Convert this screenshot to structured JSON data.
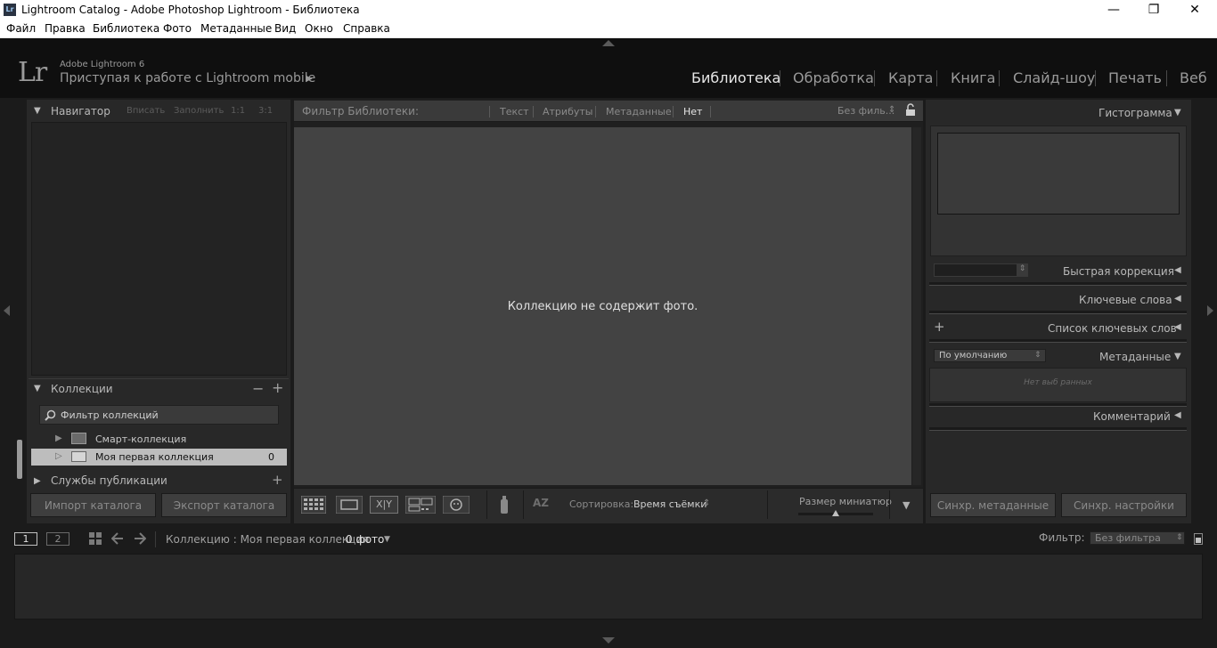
{
  "window": {
    "title": "Lightroom Catalog - Adobe Photoshop Lightroom - Библиотека",
    "app_icon": "Lr",
    "controls": [
      "—",
      "❐",
      "✕"
    ]
  },
  "menu": [
    "Файл",
    "Правка",
    "Библиотека",
    "Фото",
    "Метаданные",
    "Вид",
    "Окно",
    "Справка"
  ],
  "identity": {
    "logo": "Lr",
    "small": "Adobe Lightroom 6",
    "big": "Приступая к работе с Lightroom mobile",
    "play": "▶"
  },
  "modules": [
    "Библиотека",
    "Обработка",
    "Карта",
    "Книга",
    "Слайд-шоу",
    "Печать",
    "Веб"
  ],
  "navigator": {
    "title": "Навигатор",
    "options": [
      "Вписать",
      "Заполнить",
      "1:1",
      "3:1"
    ]
  },
  "collections": {
    "title": "Коллекции",
    "minus": "−",
    "plus": "+",
    "filter_placeholder": "Фильтр коллекций",
    "items": [
      {
        "label": "Смарт-коллекция",
        "count": ""
      },
      {
        "label": "Моя первая коллекция",
        "count": "0"
      }
    ]
  },
  "publish": {
    "title": "Службы публикации",
    "plus": "+"
  },
  "left_buttons": {
    "import": "Импорт каталога",
    "export": "Экспорт каталога"
  },
  "filter_bar": {
    "label": "Фильтр Библиотеки:",
    "tabs": [
      "Текст",
      "Атрибуты",
      "Метаданные",
      "Нет"
    ],
    "preset": "Без филь...",
    "preset_arrow": "⇕"
  },
  "grid": {
    "empty_message": "Коллекцию не содержит фото."
  },
  "toolbar": {
    "sort_label": "Сортировка:",
    "sort_value": "Время съёмки",
    "sort_arrow": "⇕",
    "thumb_label": "Размер миниатюр",
    "thumb_level": 0.5,
    "menu_arrow": "▼",
    "xy": "X|Y",
    "az": "AZ"
  },
  "right": {
    "histogram": "Гистограмма",
    "quick_develop": "Быстрая коррекция",
    "keywords": "Ключевые слова",
    "keyword_list": "Список ключевых слов",
    "keyword_plus": "+",
    "metadata": "Метаданные",
    "metadata_preset": "По умолчанию",
    "metadata_preset_arrow": "⇕",
    "no_selection": "Нет выб ранных",
    "comments": "Комментарий",
    "sync_metadata": "Синхр. метаданные",
    "sync_settings": "Синхр. настройки"
  },
  "filmstrip_bar": {
    "screen1": "1",
    "screen2": "2",
    "source": "Коллекцию : Моя первая коллекция",
    "count": "0 фото",
    "count_arrow": "▼",
    "filter_label": "Фильтр:",
    "filter_value": "Без фильтра",
    "filter_arrow": "⇕"
  },
  "colors": {
    "accent_text": "#e6e6e6",
    "panel": "#282828",
    "grid_bg": "#434343",
    "selected_row": "#bdbdbd"
  }
}
